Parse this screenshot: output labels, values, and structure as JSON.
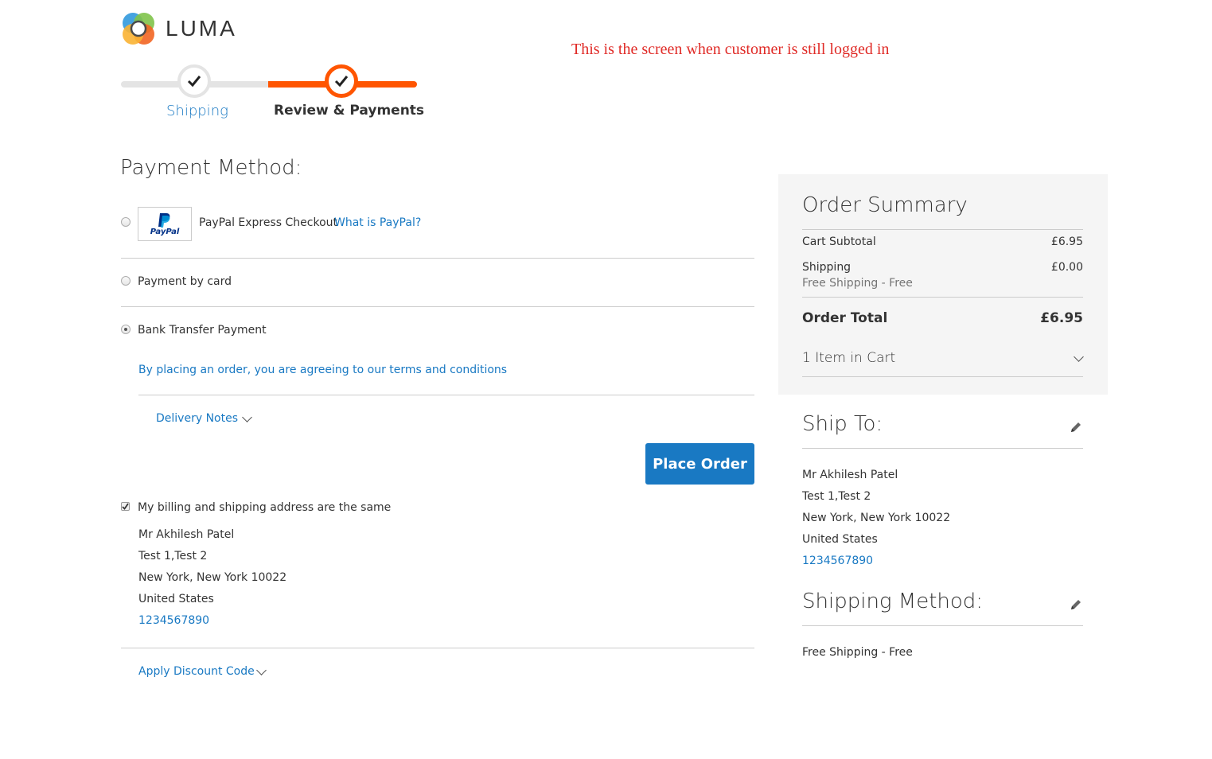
{
  "logo": {
    "text": "LUMA"
  },
  "annotation": "This is the screen when customer is still logged in",
  "progress": {
    "steps": [
      {
        "label": "Shipping",
        "state": "complete"
      },
      {
        "label": "Review & Payments",
        "state": "active"
      }
    ],
    "active_color": "#ff5501"
  },
  "payment": {
    "title": "Payment Method:",
    "methods": [
      {
        "label": "PayPal Express Checkout",
        "link": "What is PayPal?",
        "logo_text": "PayPal",
        "selected": false
      },
      {
        "label": "Payment by card",
        "selected": false
      },
      {
        "label": "Bank Transfer Payment",
        "selected": true
      }
    ],
    "terms_link": "By placing an order, you are agreeing to our terms and conditions",
    "delivery_notes": "Delivery Notes",
    "place_order": "Place Order",
    "billing_same_label": "My billing and shipping address are the same",
    "billing_same_checked": true,
    "billing_address": {
      "name": "Mr Akhilesh Patel",
      "street": "Test 1,Test 2",
      "city": "New York, New York 10022",
      "country": "United States",
      "phone": "1234567890"
    },
    "discount": "Apply Discount Code"
  },
  "summary": {
    "title": "Order Summary",
    "cart_subtotal_label": "Cart Subtotal",
    "cart_subtotal_value": "£6.95",
    "shipping_label": "Shipping",
    "shipping_value": "£0.00",
    "shipping_method_note": "Free Shipping - Free",
    "order_total_label": "Order Total",
    "order_total_value": "£6.95",
    "items_in_cart": "1 Item in Cart"
  },
  "ship_to": {
    "title": "Ship To:",
    "name": "Mr Akhilesh Patel",
    "street": "Test 1,Test 2",
    "city": "New York, New York 10022",
    "country": "United States",
    "phone": "1234567890"
  },
  "shipping_method": {
    "title": "Shipping Method:",
    "value": "Free Shipping - Free"
  },
  "colors": {
    "link": "#1979c3",
    "primary_button": "#1979c3",
    "annotation": "#e02b27"
  }
}
